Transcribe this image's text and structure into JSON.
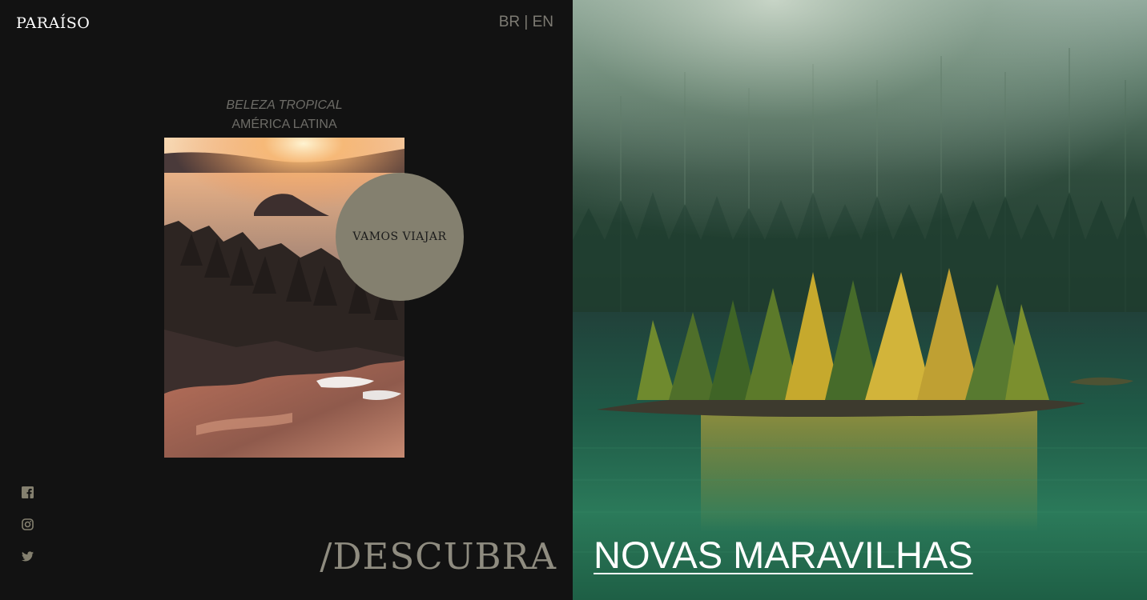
{
  "header": {
    "logo": "PARAÍSO",
    "lang_br": "BR",
    "lang_separator": "|",
    "lang_en": "EN"
  },
  "hero": {
    "tagline_line1": "BELEZA TROPICAL",
    "tagline_line2": "AMÉRICA LATINA",
    "cta_label": "VAMOS VIAJAR",
    "discover_text": "/DESCUBRA",
    "wonders_link": "NOVAS MARAVILHAS"
  },
  "social": [
    {
      "name": "facebook-icon"
    },
    {
      "name": "instagram-icon"
    },
    {
      "name": "twitter-icon"
    }
  ],
  "colors": {
    "background": "#121212",
    "accent_circle": "#84806f",
    "muted_text": "#7d7b73",
    "heading_text": "#8f8c80",
    "link_text": "#ffffff"
  }
}
